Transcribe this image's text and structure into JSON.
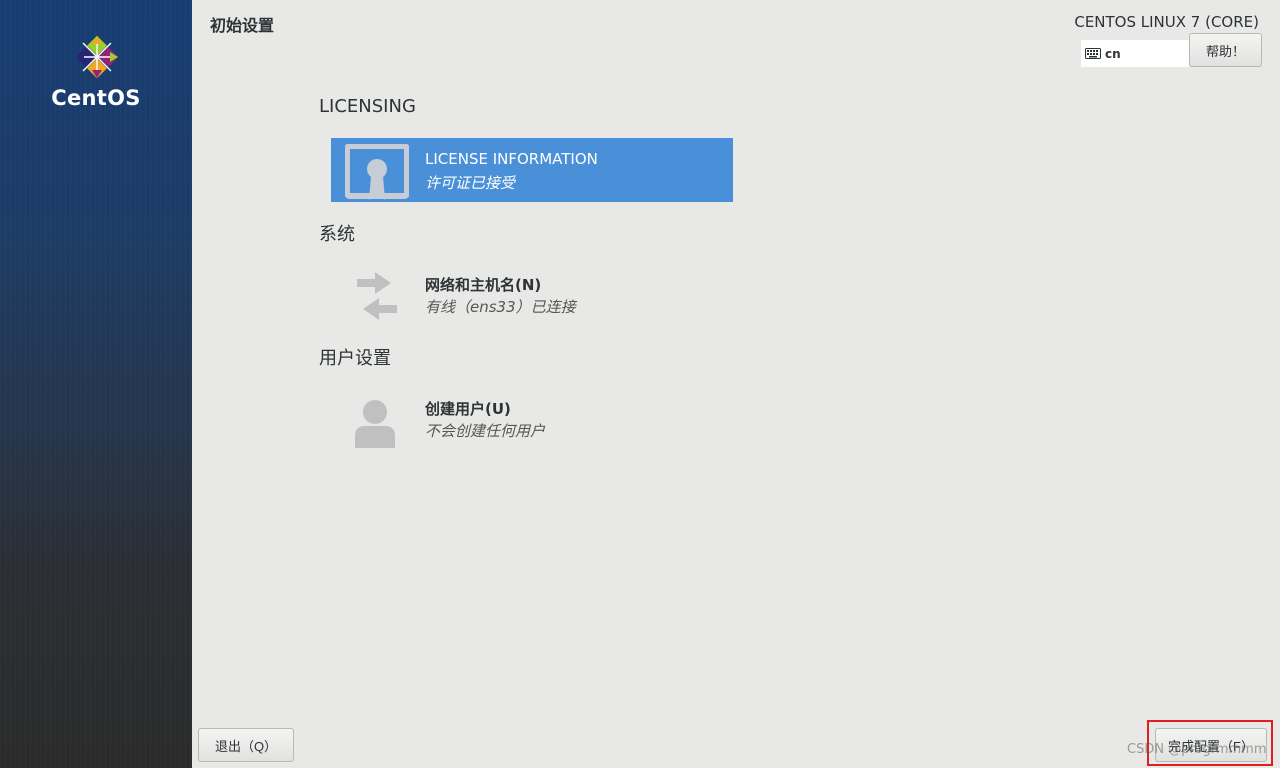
{
  "sidebar": {
    "logo_text": "CentOS"
  },
  "header": {
    "page_title": "初始设置",
    "product_name": "CENTOS LINUX 7 (CORE)",
    "keyboard_layout": "cn",
    "help_label": "帮助！"
  },
  "sections": {
    "licensing": {
      "heading": "LICENSING",
      "spoke": {
        "title": "LICENSE INFORMATION",
        "status": "许可证已接受",
        "icon": "certificate-icon"
      }
    },
    "system": {
      "heading": "系统",
      "spoke": {
        "title": "网络和主机名(N)",
        "status": "有线（ens33）已连接",
        "icon": "network-arrows-icon"
      }
    },
    "user": {
      "heading": "用户设置",
      "spoke": {
        "title": "创建用户(U)",
        "status": "不会创建任何用户",
        "icon": "user-icon"
      }
    }
  },
  "footer": {
    "quit_label": "退出（Q）",
    "finish_label": "完成配置（F）"
  },
  "watermark": "CSDN @progrmmmm",
  "colors": {
    "selected": "#4a90d9",
    "highlight": "#e02020"
  }
}
